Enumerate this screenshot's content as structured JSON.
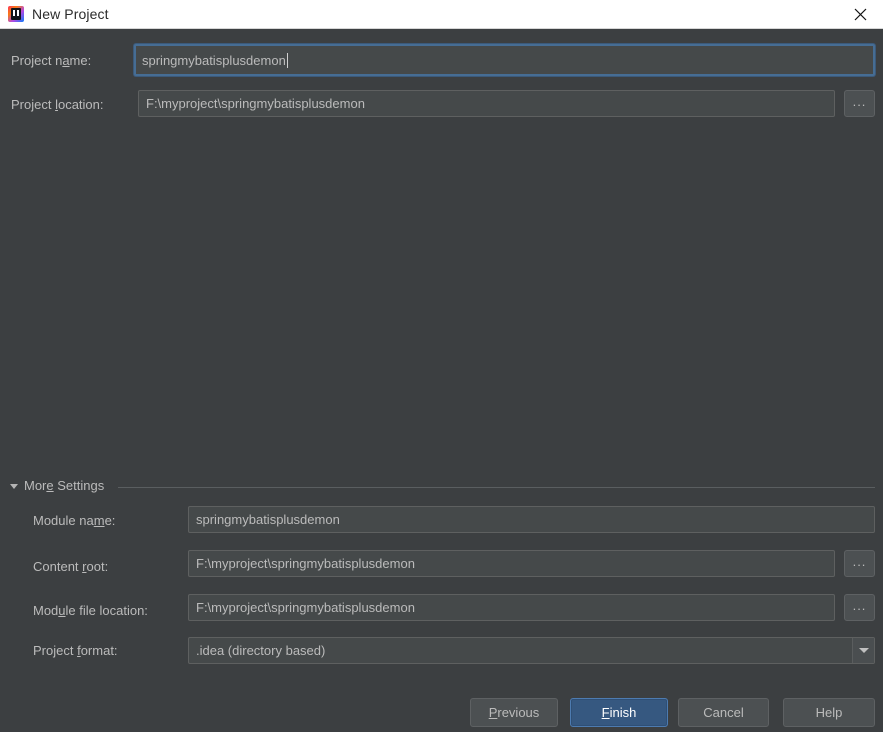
{
  "window": {
    "title": "New Project",
    "app_icon": "intellij-idea-icon",
    "close_icon": "close-icon",
    "titlebar_bg": "#ffffff",
    "dialog_bg": "#3c3f41"
  },
  "form": {
    "project_name": {
      "label_pre": "Project n",
      "label_mnemonic": "a",
      "label_post": "me:",
      "value": "springmybatisplusdemon",
      "focused": true
    },
    "project_location": {
      "label_pre": "Project ",
      "label_mnemonic": "l",
      "label_post": "ocation:",
      "value": "F:\\myproject\\springmybatisplusdemon",
      "browse_label": "..."
    }
  },
  "more_settings": {
    "label_pre": "Mor",
    "label_mnemonic": "e",
    "label_post": " Settings",
    "expanded": true,
    "triangle_icon": "chevron-down-icon",
    "rows": {
      "module_name": {
        "label_pre": "Module na",
        "label_mnemonic": "m",
        "label_post": "e:",
        "value": "springmybatisplusdemon"
      },
      "content_root": {
        "label_pre": "Content ",
        "label_mnemonic": "r",
        "label_post": "oot:",
        "value": "F:\\myproject\\springmybatisplusdemon",
        "browse_label": "..."
      },
      "module_file_location": {
        "label_pre": "Mod",
        "label_mnemonic": "u",
        "label_post": "le file location:",
        "value": "F:\\myproject\\springmybatisplusdemon",
        "browse_label": "..."
      },
      "project_format": {
        "label_pre": "Project ",
        "label_mnemonic": "f",
        "label_post": "ormat:",
        "value": ".idea (directory based)",
        "arrow_icon": "chevron-down-icon"
      }
    }
  },
  "buttons": {
    "previous": {
      "pre": "",
      "mnemonic": "P",
      "post": "revious"
    },
    "finish": {
      "pre": "",
      "mnemonic": "F",
      "post": "inish",
      "is_default": true,
      "accent": "#365880"
    },
    "cancel": {
      "pre": "Cancel",
      "mnemonic": "",
      "post": ""
    },
    "help": {
      "pre": "Help",
      "mnemonic": "",
      "post": ""
    }
  }
}
